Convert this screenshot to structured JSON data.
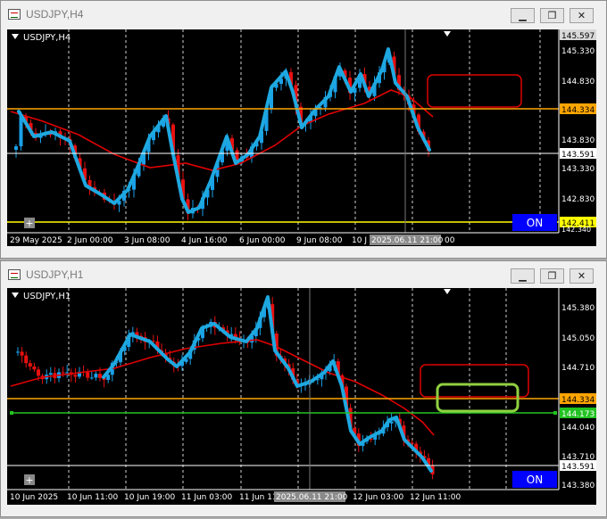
{
  "top": {
    "window_title": "USDJPY,H4",
    "chart_label": "USDJPY,H4",
    "price_labels": [
      "145.597",
      "145.330",
      "144.830",
      "144.334",
      "143.830",
      "143.591",
      "143.330",
      "142.830",
      "142.411",
      "142.340"
    ],
    "time_labels": [
      "29 May 2025",
      "2 Jun 00:00",
      "3 Jun 08:00",
      "4 Jun 16:00",
      "6 Jun 00:00",
      "9 Jun 08:00",
      "10 J"
    ],
    "time_tail": "00",
    "crosshair_time": "2025.06.11 21:00",
    "on_label": "ON",
    "colors": {
      "orange_line": "#ffa500",
      "yellow_line": "#ffff00",
      "ma": "#e00000",
      "trace": "#1ea8e0",
      "bull": "#1aa0e8",
      "bear": "#e81010"
    }
  },
  "bottom": {
    "window_title": "USDJPY,H1",
    "chart_label": "USDJPY,H1",
    "price_labels": [
      "145.380",
      "145.050",
      "144.710",
      "144.334",
      "144.173",
      "144.040",
      "143.710",
      "143.591",
      "143.380"
    ],
    "time_labels": [
      "10 Jun 2025",
      "10 Jun 11:00",
      "10 Jun 19:00",
      "11 Jun 03:00",
      "11 Jun 11",
      "12 Jun 03:00",
      "12 Jun 11:00"
    ],
    "crosshair_time": "2025.06.11 21:00",
    "on_label": "ON",
    "colors": {
      "orange_line": "#ffa500",
      "green_line": "#22c322",
      "ma": "#e00000",
      "trace": "#1ea8e0",
      "bull": "#1aa0e8",
      "bear": "#e81010",
      "green_box": "#90d040"
    }
  },
  "window_buttons": {
    "minimize": "▁",
    "restore": "❐",
    "close": "✕"
  }
}
